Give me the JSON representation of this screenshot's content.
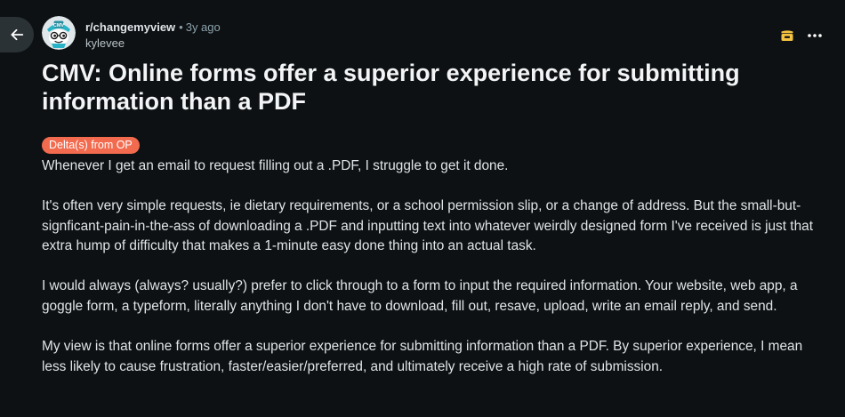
{
  "header": {
    "subreddit": "r/changemyview",
    "separator": "•",
    "time_ago": "3y ago",
    "author": "kylevee"
  },
  "icons": {
    "back": "arrow-left-icon",
    "avatar": "subreddit-avatar-icon",
    "award": "award-icon",
    "more": "more-horizontal-icon"
  },
  "post": {
    "title": "CMV: Online forms offer a superior experience for submitting information than a PDF",
    "flair": "Delta(s) from OP",
    "paragraphs": [
      "Whenever I get an email to request filling out a .PDF, I struggle to get it done.",
      "It's often very simple requests, ie dietary requirements, or a school permission slip, or a change of address. But the small-but-signficant-pain-in-the-ass of downloading a .PDF and inputting text into whatever weirdly designed form I've received is just that extra hump of difficulty that makes a 1-minute easy done thing into an actual task.",
      "I would always (always? usually?) prefer to click through to a form to input the required information. Your website, web app, a goggle form, a typeform, literally anything I don't have to download, fill out, resave, upload, write an email reply, and send.",
      "My view is that online forms offer a superior experience for submitting information than a PDF. By superior experience, I mean less likely to cause frustration, faster/easier/preferred, and ultimately receive a high rate of submission."
    ]
  },
  "colors": {
    "background": "#0e1113",
    "flair_bg": "#f26b4f",
    "text": "#dfe4e8",
    "muted": "#8ba2ad"
  }
}
